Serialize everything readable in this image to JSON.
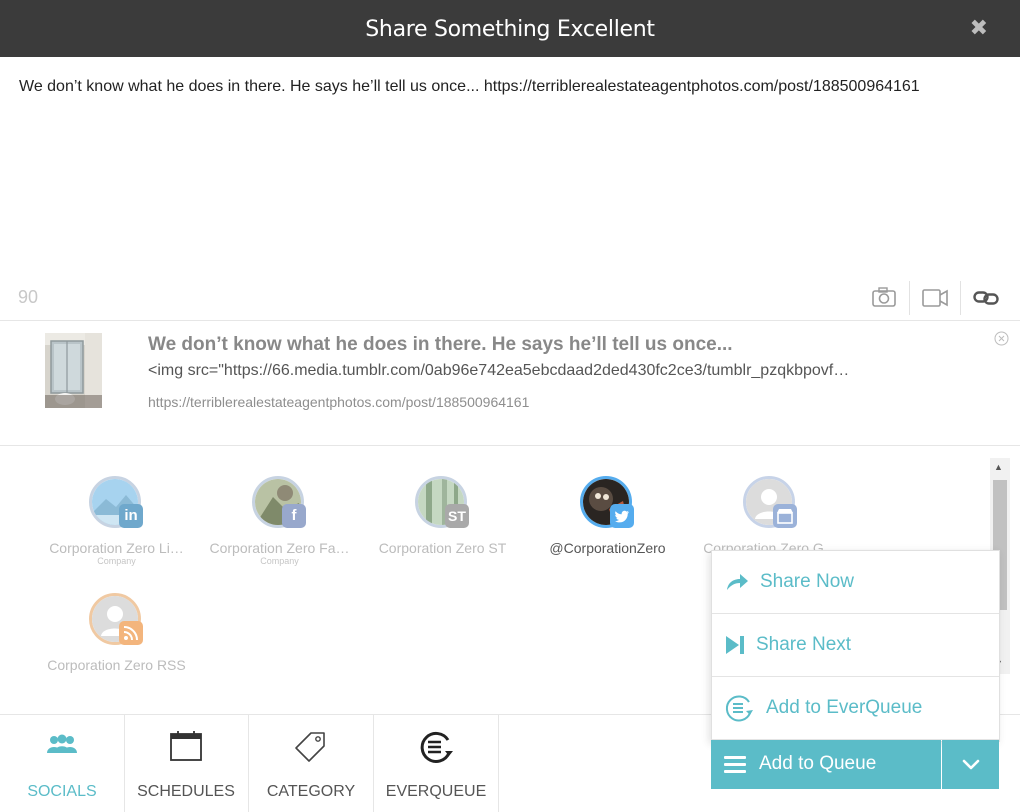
{
  "window": {
    "title": "Share Something Excellent",
    "close_icon": "close-icon"
  },
  "compose": {
    "text": "We don’t know what he does in there. He says he’ll tell us once... https://terriblerealestateagentphotos.com/post/188500964161",
    "char_count": "90"
  },
  "toolbar": {
    "icons": [
      "camera-icon",
      "video-icon",
      "link-icon"
    ]
  },
  "preview": {
    "title": "We don’t know what he does in there. He says he’ll tell us once...",
    "description": "<img src=\"https://66.media.tumblr.com/0ab96e742ea5ebcdaad2ded430fc2ce3/tumblr_pzqkbpovf…",
    "url": "https://terriblerealestateagentphotos.com/post/188500964161"
  },
  "socials": [
    {
      "name": "Corporation Zero Li…",
      "sub": "Company",
      "network": "linkedin",
      "badge": "in",
      "active": false
    },
    {
      "name": "Corporation Zero Fa…",
      "sub": "Company",
      "network": "facebook",
      "badge": "f",
      "active": false
    },
    {
      "name": "Corporation Zero ST",
      "sub": "",
      "network": "smarttask",
      "badge": "ST",
      "active": false
    },
    {
      "name": "@CorporationZero",
      "sub": "",
      "network": "twitter",
      "badge": "",
      "active": true
    },
    {
      "name": "Corporation Zero G…",
      "sub": "",
      "network": "google-my-business",
      "badge": "",
      "active": false
    },
    {
      "name": "Corporation Zero RSS",
      "sub": "",
      "network": "rss",
      "badge": "",
      "active": false
    }
  ],
  "tabs": [
    {
      "label": "SOCIALS",
      "icon": "users-icon",
      "active": true
    },
    {
      "label": "SCHEDULES",
      "icon": "calendar-icon",
      "active": false
    },
    {
      "label": "CATEGORY",
      "icon": "tag-icon",
      "active": false
    },
    {
      "label": "EVERQUEUE",
      "icon": "everqueue-icon",
      "active": false
    }
  ],
  "share_menu": {
    "share_now": "Share Now",
    "share_next": "Share Next",
    "add_everqueue": "Add to EverQueue"
  },
  "queue_button": {
    "label": "Add to Queue"
  },
  "colors": {
    "accent": "#5bbcc8",
    "titlebar": "#3b3b3b",
    "twitter": "#55acee",
    "linkedin": "#0077b5",
    "facebook": "#3b5998",
    "rss": "#f0a050"
  }
}
